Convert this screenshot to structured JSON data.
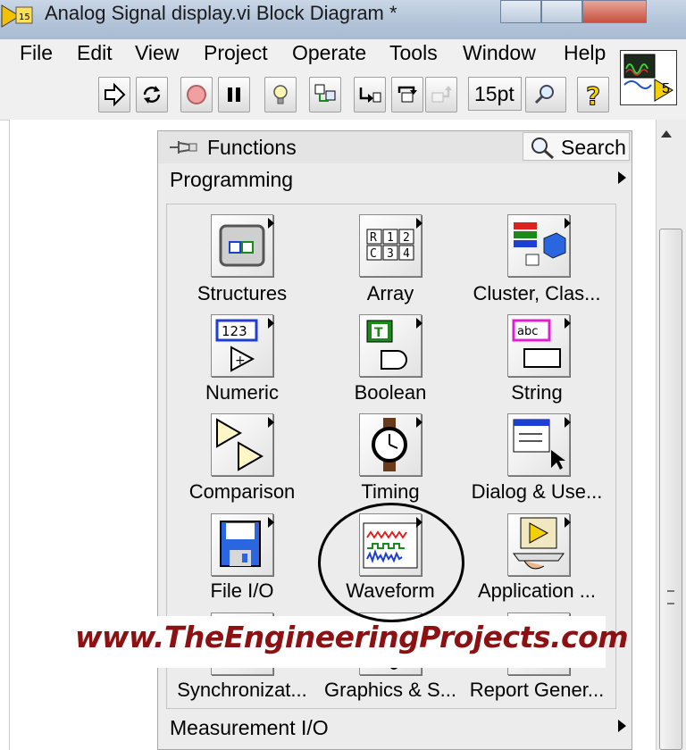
{
  "window": {
    "title": "Analog Signal display.vi Block Diagram *"
  },
  "menu": [
    "File",
    "Edit",
    "View",
    "Project",
    "Operate",
    "Tools",
    "Window",
    "Help"
  ],
  "toolbar": {
    "font_size": "15pt"
  },
  "vi_icon": {
    "connector_label": "5"
  },
  "palette": {
    "title": "Functions",
    "search_label": "Search",
    "category_open": "Programming",
    "category_next": "Measurement I/O",
    "tiles": [
      {
        "label": "Structures",
        "icon": "structures-icon"
      },
      {
        "label": "Array",
        "icon": "array-icon",
        "glyphs": [
          "R",
          "1",
          "2",
          "C",
          "3",
          "4"
        ]
      },
      {
        "label": "Cluster, Clas...",
        "icon": "cluster-icon"
      },
      {
        "label": "Numeric",
        "icon": "numeric-icon",
        "glyph": "123"
      },
      {
        "label": "Boolean",
        "icon": "boolean-icon",
        "glyph": "T"
      },
      {
        "label": "String",
        "icon": "string-icon",
        "glyph": "abc"
      },
      {
        "label": "Comparison",
        "icon": "comparison-icon"
      },
      {
        "label": "Timing",
        "icon": "timing-icon"
      },
      {
        "label": "Dialog & Use...",
        "icon": "dialog-icon"
      },
      {
        "label": "File I/O",
        "icon": "file-io-icon"
      },
      {
        "label": "Waveform",
        "icon": "waveform-icon"
      },
      {
        "label": "Application ...",
        "icon": "application-control-icon"
      },
      {
        "label": "Synchronizat...",
        "icon": "synchronization-icon"
      },
      {
        "label": "Graphics & S...",
        "icon": "graphics-sound-icon"
      },
      {
        "label": "Report Gener...",
        "icon": "report-generation-icon"
      }
    ]
  },
  "watermark": "www.TheEngineeringProjects.com",
  "colors": {
    "watermark": "#8b1113",
    "titlebar": "#b9c9dd"
  }
}
